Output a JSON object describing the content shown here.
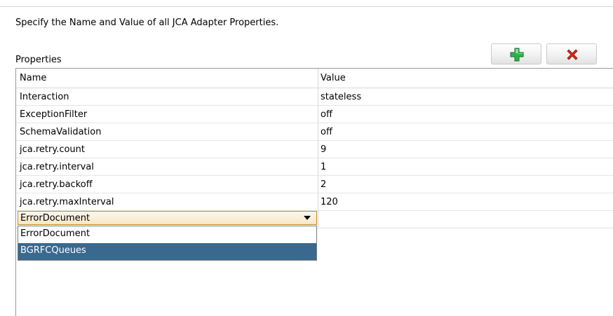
{
  "instruction": "Specify the Name and Value of all JCA Adapter Properties.",
  "section_label": "Properties",
  "toolbar": {
    "add_icon": "add-plus-icon",
    "delete_icon": "delete-x-icon",
    "colors": {
      "add": "#2fb14a",
      "delete": "#d42a1a"
    }
  },
  "table": {
    "headers": {
      "name": "Name",
      "value": "Value"
    },
    "rows": [
      {
        "name": "Interaction",
        "value": "stateless"
      },
      {
        "name": "ExceptionFilter",
        "value": "off"
      },
      {
        "name": "SchemaValidation",
        "value": "off"
      },
      {
        "name": "jca.retry.count",
        "value": "9"
      },
      {
        "name": "jca.retry.interval",
        "value": "1"
      },
      {
        "name": "jca.retry.backoff",
        "value": "2"
      },
      {
        "name": "jca.retry.maxInterval",
        "value": "120"
      }
    ],
    "editing_row": {
      "selected": "ErrorDocument",
      "options": [
        "ErrorDocument",
        "BGRFCQueues"
      ],
      "highlighted_option": "BGRFCQueues"
    }
  }
}
